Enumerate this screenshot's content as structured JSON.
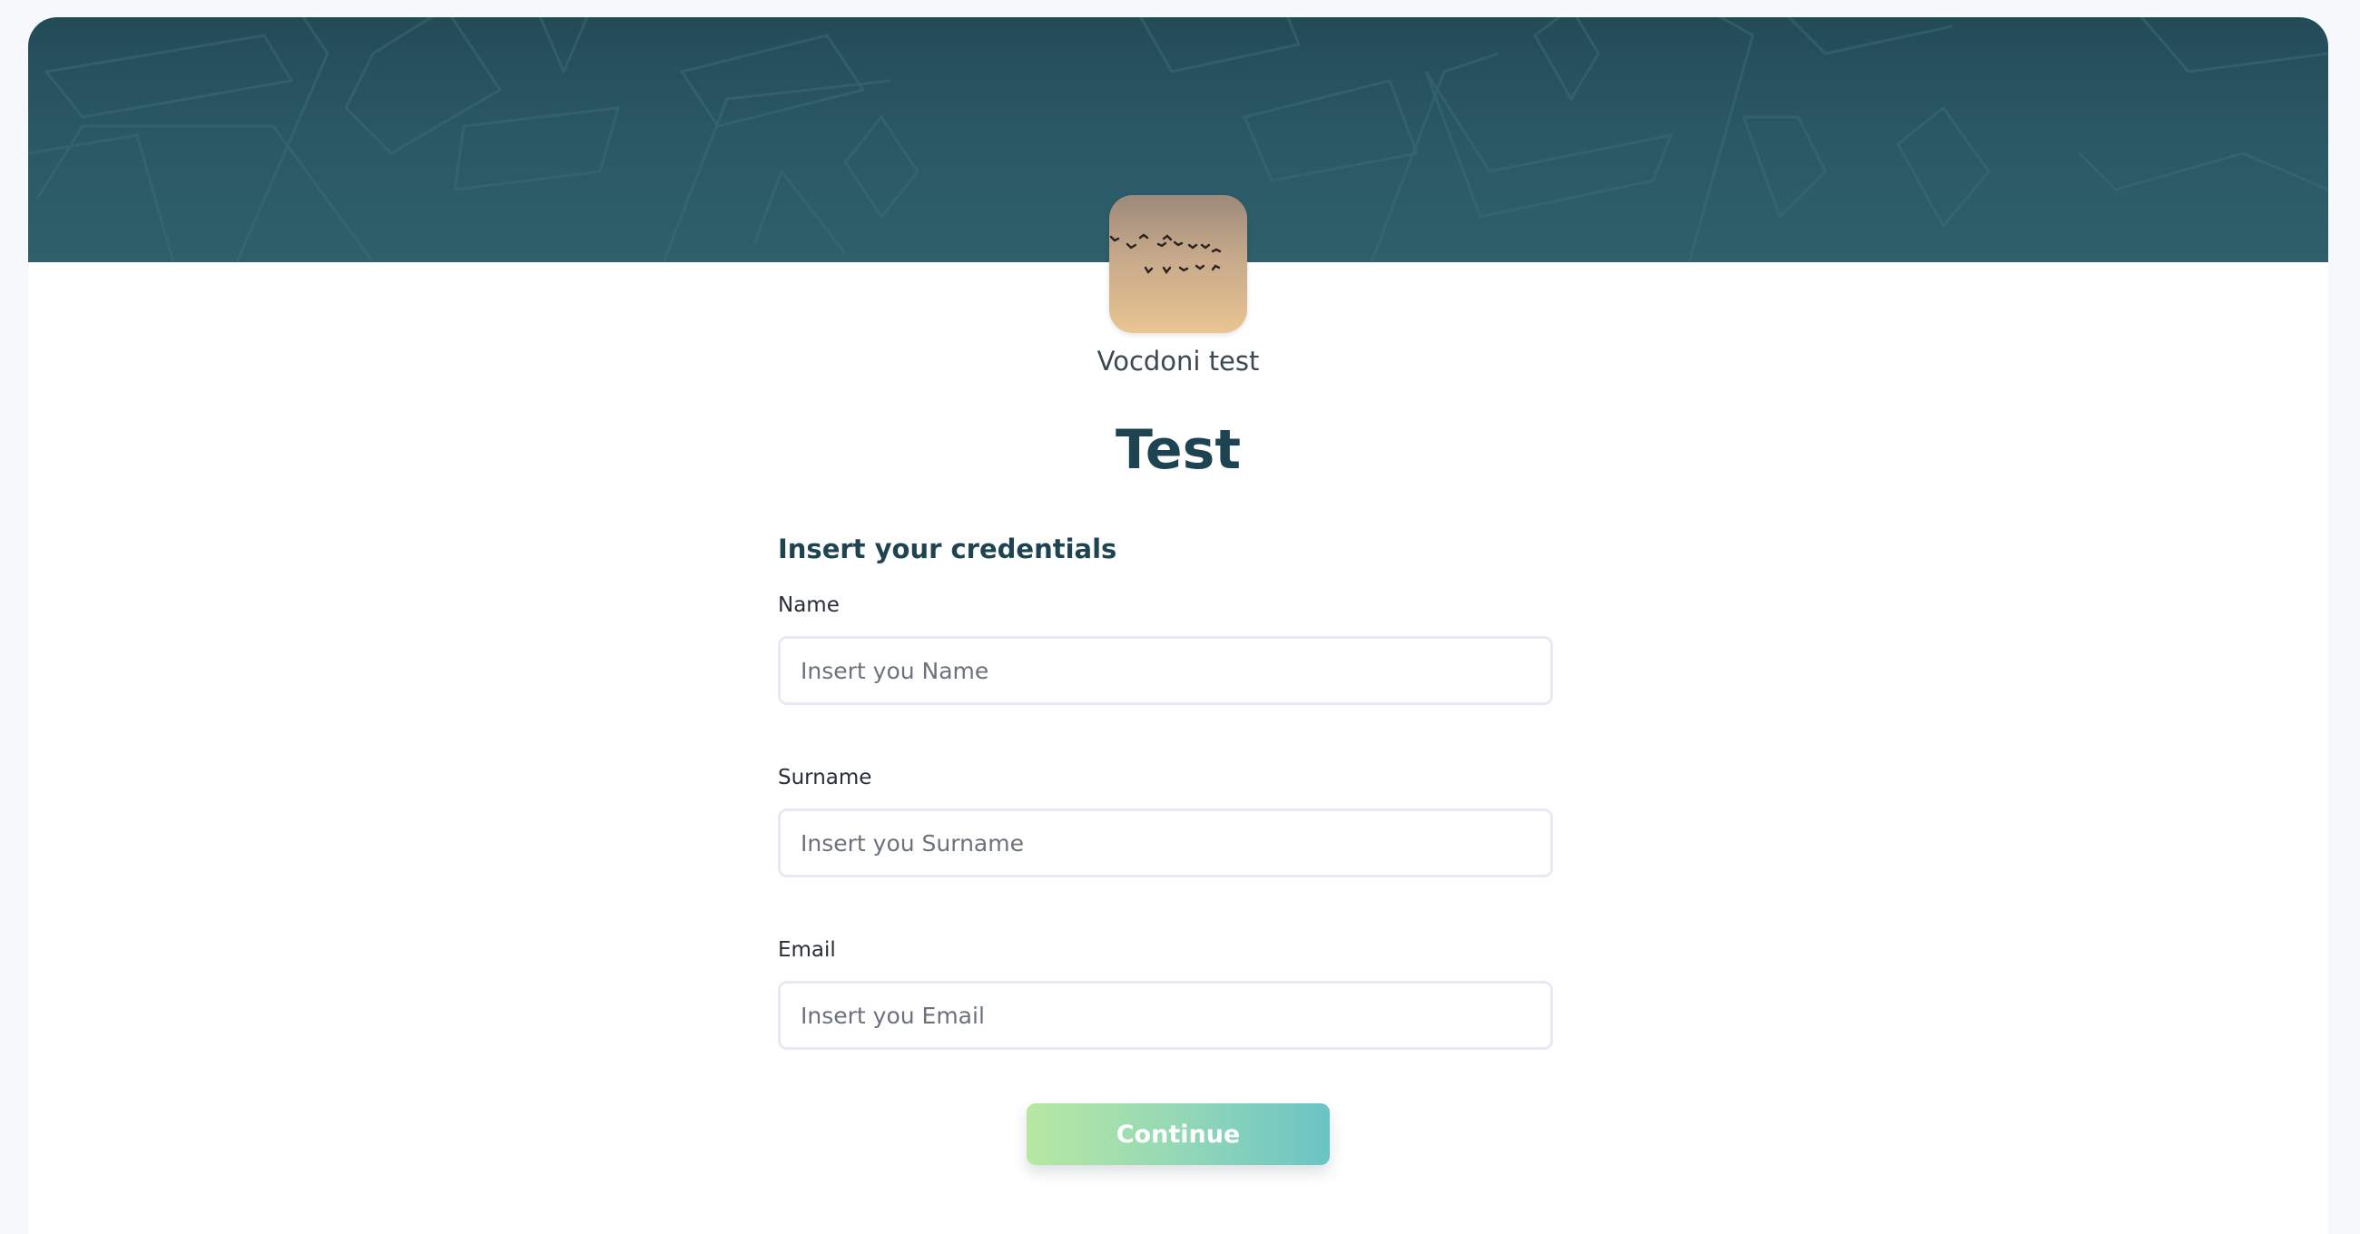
{
  "organization": {
    "name": "Vocdoni test",
    "avatar_icon": "birds-sunset-image"
  },
  "process": {
    "title": "Test"
  },
  "form": {
    "heading": "Insert your credentials",
    "fields": [
      {
        "label": "Name",
        "placeholder": "Insert you Name",
        "value": ""
      },
      {
        "label": "Surname",
        "placeholder": "Insert you Surname",
        "value": ""
      },
      {
        "label": "Email",
        "placeholder": "Insert you Email",
        "value": ""
      }
    ],
    "submit_label": "Continue"
  },
  "colors": {
    "banner": "#2b5a66",
    "title": "#1d4450",
    "button_gradient_start": "#b7e8a2",
    "button_gradient_end": "#6ac4c4"
  }
}
